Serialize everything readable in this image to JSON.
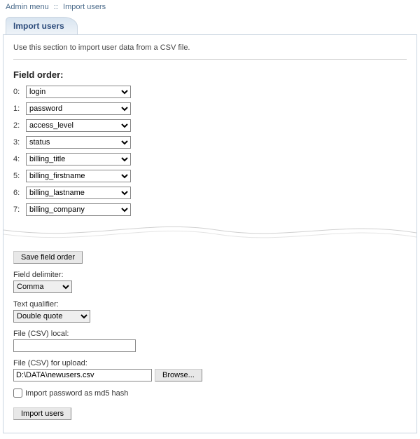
{
  "breadcrumb": {
    "admin_menu": "Admin menu",
    "separator": "::",
    "current": "Import users"
  },
  "header": {
    "title": "Import users"
  },
  "intro": "Use this section to import user data from a CSV file.",
  "field_order": {
    "title": "Field order:",
    "rows": [
      {
        "idx": "0:",
        "value": "login"
      },
      {
        "idx": "1:",
        "value": "password"
      },
      {
        "idx": "2:",
        "value": "access_level"
      },
      {
        "idx": "3:",
        "value": "status"
      },
      {
        "idx": "4:",
        "value": "billing_title"
      },
      {
        "idx": "5:",
        "value": "billing_firstname"
      },
      {
        "idx": "6:",
        "value": "billing_lastname"
      },
      {
        "idx": "7:",
        "value": "billing_company"
      }
    ]
  },
  "buttons": {
    "save_order": "Save field order",
    "browse": "Browse...",
    "import": "Import users"
  },
  "delimiter": {
    "label": "Field delimiter:",
    "value": "Comma"
  },
  "qualifier": {
    "label": "Text qualifier:",
    "value": "Double quote"
  },
  "file_local": {
    "label": "File (CSV) local:",
    "value": ""
  },
  "file_upload": {
    "label": "File (CSV) for upload:",
    "value": "D:\\DATA\\newusers.csv"
  },
  "md5_checkbox": {
    "label": "Import password as md5 hash",
    "checked": false
  }
}
